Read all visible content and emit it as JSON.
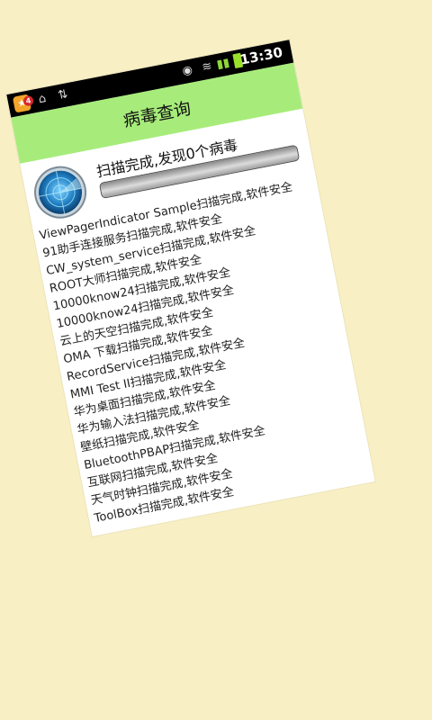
{
  "status_bar": {
    "badge_count": "4",
    "time": "13:30"
  },
  "header": {
    "title": "病毒查询"
  },
  "scan": {
    "status_text": "扫描完成,发现0个病毒",
    "progress_percent": 100
  },
  "results": [
    "ViewPagerIndicator Sample扫描完成,软件安全",
    "91助手连接服务扫描完成,软件安全",
    "CW_system_service扫描完成,软件安全",
    "ROOT大师扫描完成,软件安全",
    "10000know24扫描完成,软件安全",
    "10000know24扫描完成,软件安全",
    "云上的天空扫描完成,软件安全",
    "OMA 下载扫描完成,软件安全",
    "RecordService扫描完成,软件安全",
    "MMI Test II扫描完成,软件安全",
    "华为桌面扫描完成,软件安全",
    "华为输入法扫描完成,软件安全",
    "壁纸扫描完成,软件安全",
    "BluetoothPBAP扫描完成,软件安全",
    "互联网扫描完成,软件安全",
    "天气时钟扫描完成,软件安全",
    "ToolBox扫描完成,软件安全"
  ],
  "colors": {
    "background": "#f8f0c4",
    "titlebar": "#a7ec7a",
    "statusbar": "#000000"
  }
}
